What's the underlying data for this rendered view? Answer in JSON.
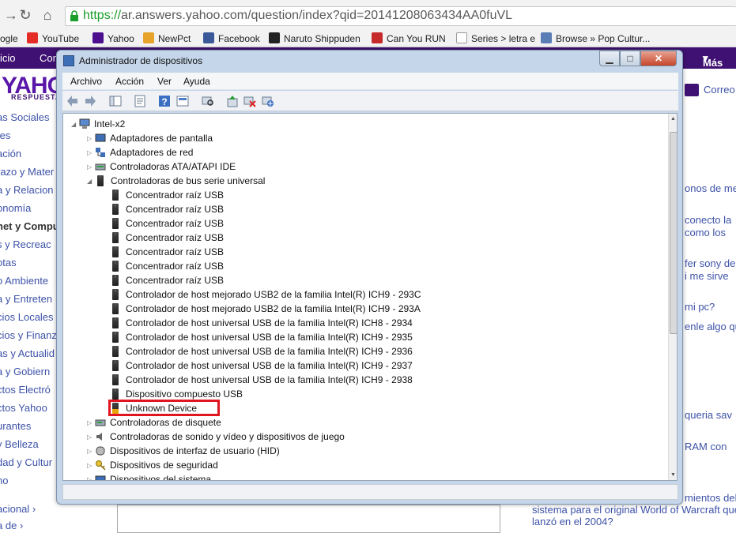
{
  "browser": {
    "url_https": "https://",
    "url_rest": "ar.answers.yahoo.com/question/index?qid=20141208063434AA0fuVL",
    "bookmarks": [
      {
        "label": "ogle",
        "icon": "google-icon"
      },
      {
        "label": "YouTube",
        "icon": "youtube-icon"
      },
      {
        "label": "Yahoo",
        "icon": "yahoo-icon"
      },
      {
        "label": "NewPct",
        "icon": "newpct-icon"
      },
      {
        "label": "Facebook",
        "icon": "facebook-icon"
      },
      {
        "label": "Naruto Shippuden",
        "icon": "vp-icon"
      },
      {
        "label": "Can You RUN",
        "icon": "canyourun-icon"
      },
      {
        "label": "Series > letra e",
        "icon": "page-icon"
      },
      {
        "label": "Browse » Pop Cultur...",
        "icon": "popculture-icon"
      }
    ]
  },
  "yahoo": {
    "nav_left": "icio",
    "nav_left2": "Cor",
    "nav_right": "Más",
    "logo": "YAHO",
    "logo_sub": "RESPUESTA",
    "correo": "Correo",
    "sidebar": [
      "as Sociales",
      "tes",
      "ación",
      "razo y Mater",
      "a y Relacion",
      "onomía",
      "net y Compu",
      "s y Recreac",
      "otas",
      "o Ambiente",
      "a y Entreten",
      "cios Locales",
      "cios y Finanz",
      "as y Actualid",
      "a y Gobiern",
      "ctos Electró",
      "ctos Yahoo",
      "urantes",
      "y Belleza",
      "dad y Cultur",
      "no",
      "acional",
      "a de"
    ],
    "right_snippets": [
      "onos de me",
      "conecto la",
      "como los",
      "fer sony de",
      "i me sirve",
      "mi pc?",
      "enle algo qu",
      "queria sav",
      "RAM con",
      "mientos del"
    ],
    "bottom_question_1": "sistema para el original World of Warcraft que",
    "bottom_question_2": "lanzó en el 2004?"
  },
  "window": {
    "title": "Administrador de dispositivos",
    "menu": [
      "Archivo",
      "Acción",
      "Ver",
      "Ayuda"
    ],
    "root": "Intel-x2",
    "categories_top": [
      "Adaptadores de pantalla",
      "Adaptadores de red",
      "Controladoras ATA/ATAPI IDE",
      "Controladoras de bus serie universal"
    ],
    "usb_devices": [
      "Concentrador raíz USB",
      "Concentrador raíz USB",
      "Concentrador raíz USB",
      "Concentrador raíz USB",
      "Concentrador raíz USB",
      "Concentrador raíz USB",
      "Concentrador raíz USB",
      "Controlador de host mejorado USB2 de la familia Intel(R) ICH9 - 293C",
      "Controlador de host mejorado USB2 de la familia Intel(R) ICH9 - 293A",
      "Controlador de host universal USB de la familia Intel(R) ICH8 - 2934",
      "Controlador de host universal USB de la familia Intel(R) ICH9 - 2935",
      "Controlador de host universal USB de la familia Intel(R) ICH9 - 2936",
      "Controlador de host universal USB de la familia Intel(R) ICH9 - 2937",
      "Controlador de host universal USB de la familia Intel(R) ICH9 - 2938",
      "Dispositivo compuesto USB"
    ],
    "unknown_device": "Unknown Device",
    "categories_bottom": [
      "Controladoras de disquete",
      "Controladoras de sonido y vídeo y dispositivos de juego",
      "Dispositivos de interfaz de usuario (HID)",
      "Dispositivos de seguridad",
      "Dispositivos del sistema"
    ],
    "highlight_color": "#e01520"
  }
}
